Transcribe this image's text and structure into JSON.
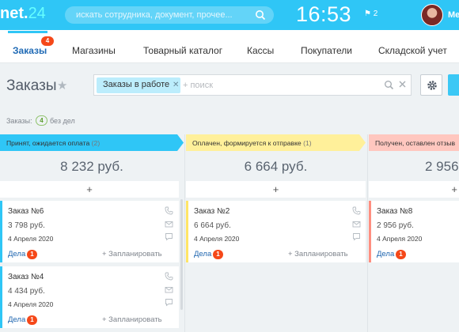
{
  "header": {
    "logo_main": "net.",
    "logo_num": "24",
    "search_placeholder": "искать сотрудника, документ, прочее...",
    "clock": "16:53",
    "flag_count": "2",
    "user_name": "Me"
  },
  "tabs": [
    {
      "label": "Заказы",
      "badge": "4",
      "active": true
    },
    {
      "label": "Магазины"
    },
    {
      "label": "Товарный каталог"
    },
    {
      "label": "Кассы"
    },
    {
      "label": "Покупатели"
    },
    {
      "label": "Складской учет"
    }
  ],
  "page": {
    "title": "Заказы",
    "filter_chip": "Заказы в работе",
    "filter_placeholder": "+ поиск",
    "counter_label": "Заказы:",
    "counter_value": "4",
    "counter_tail": "без дел"
  },
  "columns": [
    {
      "title": "Принят, ожидается оплата",
      "count": "(2)",
      "color": "#2fc6f6",
      "sum": "8 232 руб.",
      "plus": "+",
      "cards": [
        {
          "title": "Заказ №6",
          "sum": "3 798 руб.",
          "date": "4 Апреля 2020",
          "deals_label": "Дела",
          "deals_count": "1",
          "plan": "+ Запланировать"
        },
        {
          "title": "Заказ №4",
          "sum": "4 434 руб.",
          "date": "4 Апреля 2020",
          "deals_label": "Дела",
          "deals_count": "1",
          "plan": "+ Запланировать"
        }
      ]
    },
    {
      "title": "Оплачен, формируется к отправке",
      "count": "(1)",
      "color": "#fff09a",
      "sum": "6 664 руб.",
      "plus": "+",
      "cards": [
        {
          "title": "Заказ №2",
          "sum": "6 664 руб.",
          "date": "4 Апреля 2020",
          "deals_label": "Дела",
          "deals_count": "1",
          "plan": "+ Запланировать"
        }
      ]
    },
    {
      "title": "Получен, оставлен отзыв",
      "count": "",
      "color": "#ffc7bf",
      "sum": "2 956",
      "plus": "+",
      "cards": [
        {
          "title": "Заказ №8",
          "sum": "2 956 руб.",
          "date": "4 Апреля 2020",
          "deals_label": "Дела",
          "deals_count": "1",
          "plan": ""
        }
      ]
    }
  ]
}
